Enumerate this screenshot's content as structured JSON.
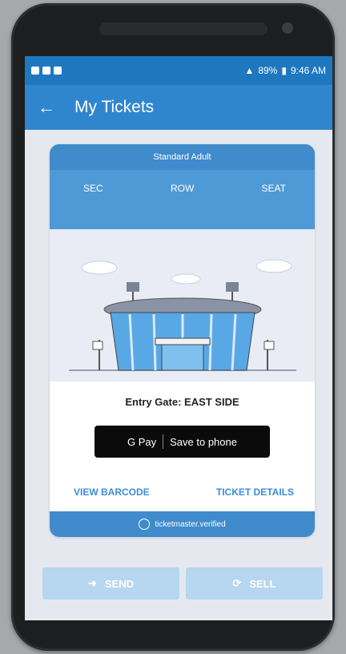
{
  "status": {
    "battery": "89%",
    "time": "9:46 AM"
  },
  "appbar": {
    "title": "My Tickets"
  },
  "ticket": {
    "type": "Standard Adult",
    "sec_label": "SEC",
    "row_label": "ROW",
    "seat_label": "SEAT",
    "entry_gate": "Entry Gate: EAST SIDE"
  },
  "gpay": {
    "brand": "G Pay",
    "label": "Save to phone"
  },
  "links": {
    "barcode": "VIEW BARCODE",
    "details": "TICKET DETAILS"
  },
  "footer": {
    "verified": "ticketmaster.verified"
  },
  "actions": {
    "send": "SEND",
    "sell": "SELL"
  }
}
